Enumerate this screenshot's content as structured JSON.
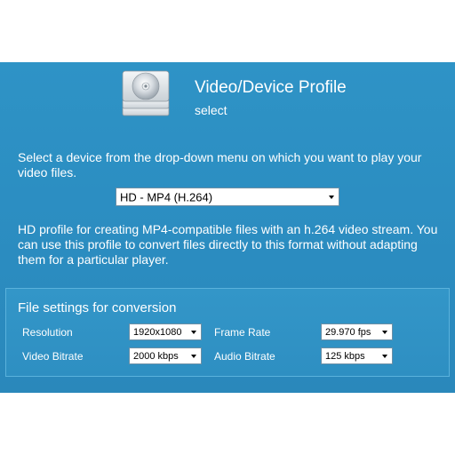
{
  "header": {
    "title": "Video/Device Profile",
    "subtitle": "select"
  },
  "instruction": "Select a device from the drop-down menu on which you want to play your video files.",
  "profile": {
    "selected": "HD - MP4 (H.264)",
    "description": "HD profile for creating MP4-compatible files with an h.264 video stream. You can use this profile to convert files directly to this format without adapting them for a particular player."
  },
  "settings": {
    "title": "File settings for conversion",
    "resolution_label": "Resolution",
    "resolution_value": "1920x1080",
    "frame_rate_label": "Frame Rate",
    "frame_rate_value": "29.970 fps",
    "video_bitrate_label": "Video Bitrate",
    "video_bitrate_value": "2000 kbps",
    "audio_bitrate_label": "Audio Bitrate",
    "audio_bitrate_value": "125 kbps"
  },
  "colors": {
    "panel_background": "#2b8cc0",
    "text": "#ffffff"
  },
  "icons": {
    "header": "disc-stack-icon",
    "dropdown_arrow": "chevron-down-icon"
  }
}
